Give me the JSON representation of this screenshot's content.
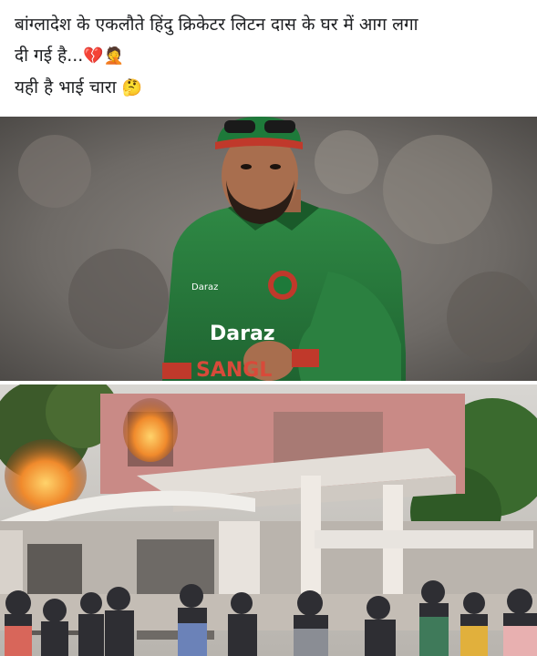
{
  "post": {
    "caption_line1": "बांग्लादेश के एकलौते हिंदु क्रिकेटर लिटन दास के घर में आग लगा",
    "caption_line2": "दी गई है...",
    "caption_line2_emoji": "💔🤦",
    "caption_line3": "यही है भाई चारा",
    "caption_line3_emoji": "🤔"
  },
  "images": {
    "top_photo": "cricketer-in-green-jersey",
    "bottom_photo": "house-on-fire-with-crowd",
    "jersey_text": "SANGL"
  },
  "colors": {
    "caption_text": "#1c1e21",
    "jersey_green": "#2a7a3c",
    "fire_orange": "#f08a2c",
    "house_pink": "#c98a86"
  }
}
